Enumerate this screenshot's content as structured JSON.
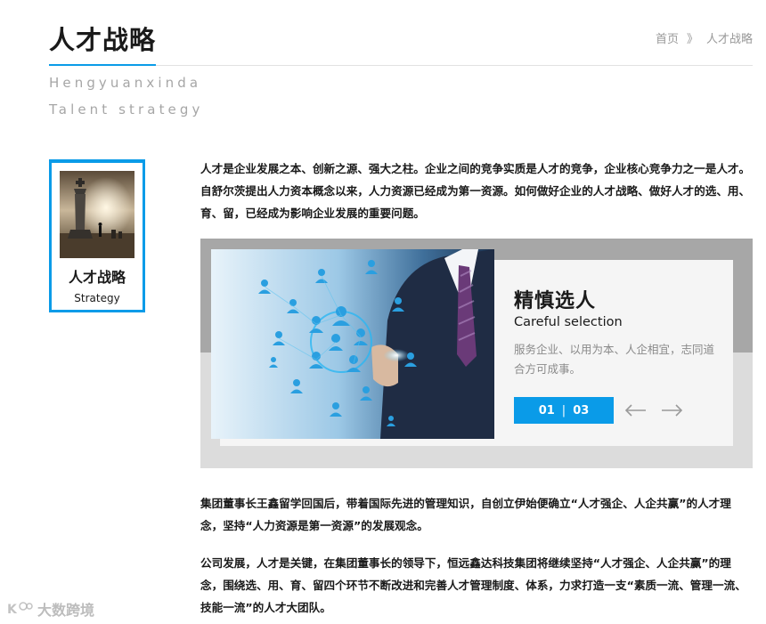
{
  "header": {
    "title": "人才战略",
    "breadcrumb": [
      {
        "label": "首页"
      },
      {
        "label": "》"
      },
      {
        "label": "人才战略"
      }
    ]
  },
  "subtitle": {
    "line1": "Hengyuanxinda",
    "line2": "Talent strategy"
  },
  "sidebar": {
    "title": "人才战略",
    "subtitle": "Strategy"
  },
  "content": {
    "intro": "人才是企业发展之本、创新之源、强大之柱。企业之间的竞争实质是人才的竞争，企业核心竞争力之一是人才。自舒尔茨提出人力资本概念以来，人力资源已经成为第一资源。如何做好企业的人才战略、做好人才的选、用、育、留，已经成为影响企业发展的重要问题。",
    "para2": "集团董事长王鑫留学回国后，带着国际先进的管理知识，自创立伊始便确立“人才强企、人企共赢”的人才理念，坚持“人力资源是第一资源”的发展观念。",
    "para3": "公司发展，人才是关键，在集团董事长的领导下，恒远鑫达科技集团将继续坚持“人才强企、人企共赢”的理念，围绕选、用、育、留四个环节不断改进和完善人才管理制度、体系，力求打造一支“素质一流、管理一流、技能一流”的人才大团队。"
  },
  "slider": {
    "heading": "精慎选人",
    "subheading": "Careful selection",
    "description": "服务企业、以用为本、人企相宜，志同道合方可成事。",
    "current": "01",
    "separator": "|",
    "total": "03",
    "progress": 0.333,
    "prev_icon": "arrow-left-icon",
    "next_icon": "arrow-right-icon"
  },
  "watermark": {
    "text": "大数跨境"
  },
  "colors": {
    "accent": "#0a9be8",
    "text": "#1a1a1a",
    "muted": "#999999",
    "slider_bg": "#dcdcdc",
    "slider_band": "#a7a7a7"
  }
}
